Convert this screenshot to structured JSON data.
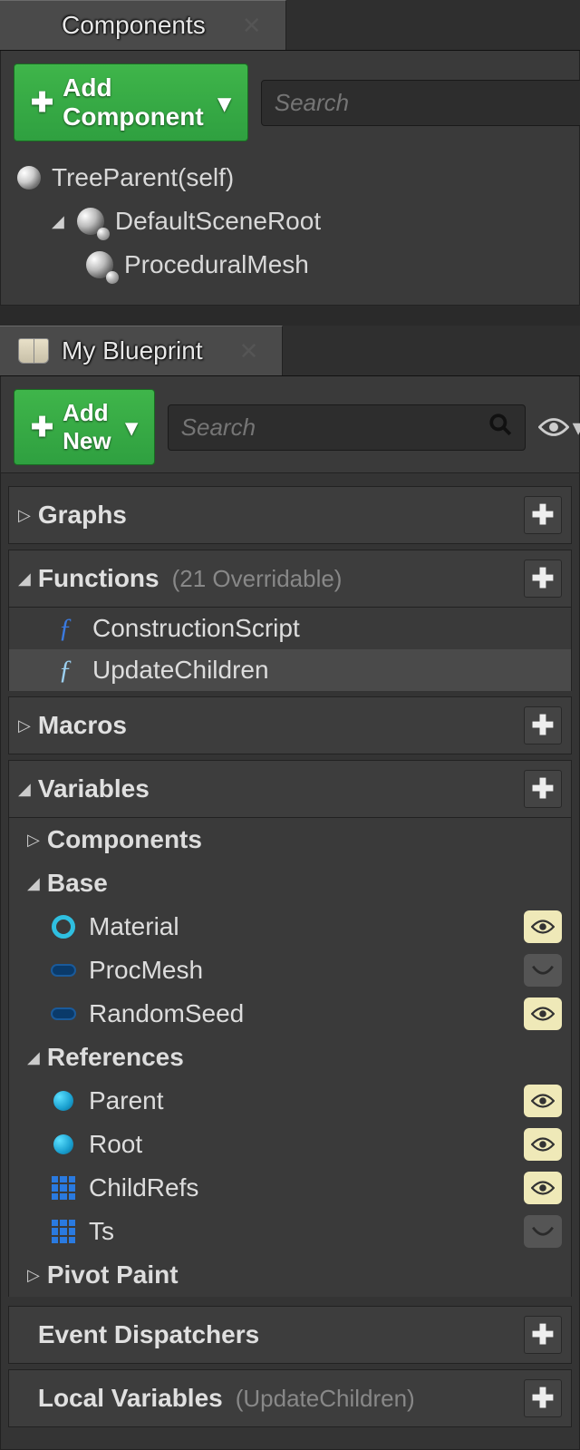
{
  "componentsPanel": {
    "tabTitle": "Components",
    "addButton": "Add Component",
    "searchPlaceholder": "Search",
    "tree": {
      "root": "TreeParent(self)",
      "sceneRoot": "DefaultSceneRoot",
      "child": "ProceduralMesh"
    }
  },
  "blueprintPanel": {
    "tabTitle": "My Blueprint",
    "addButton": "Add New",
    "searchPlaceholder": "Search",
    "sections": {
      "graphs": {
        "label": "Graphs",
        "expanded": false
      },
      "functions": {
        "label": "Functions",
        "sub": "(21 Overridable)",
        "expanded": true,
        "items": [
          {
            "name": "ConstructionScript"
          },
          {
            "name": "UpdateChildren"
          }
        ]
      },
      "macros": {
        "label": "Macros",
        "expanded": false
      },
      "variables": {
        "label": "Variables",
        "expanded": true,
        "categories": [
          {
            "name": "Components",
            "expanded": false
          },
          {
            "name": "Base",
            "expanded": true,
            "vars": [
              {
                "name": "Material",
                "icon": "ring",
                "vis": "open"
              },
              {
                "name": "ProcMesh",
                "icon": "pill",
                "vis": "closed"
              },
              {
                "name": "RandomSeed",
                "icon": "pill",
                "vis": "open"
              }
            ]
          },
          {
            "name": "References",
            "expanded": true,
            "vars": [
              {
                "name": "Parent",
                "icon": "ball",
                "vis": "open"
              },
              {
                "name": "Root",
                "icon": "ball",
                "vis": "open"
              },
              {
                "name": "ChildRefs",
                "icon": "grid",
                "vis": "open"
              },
              {
                "name": "Ts",
                "icon": "grid",
                "vis": "closed"
              }
            ]
          },
          {
            "name": "Pivot Paint",
            "expanded": false
          }
        ]
      },
      "eventDispatchers": {
        "label": "Event Dispatchers"
      },
      "localVariables": {
        "label": "Local Variables",
        "sub": "(UpdateChildren)"
      }
    }
  }
}
